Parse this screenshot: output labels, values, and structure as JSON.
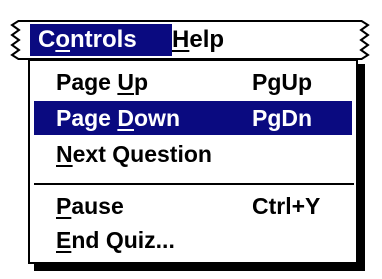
{
  "menubar": {
    "menus": [
      {
        "pre": "C",
        "accel": "o",
        "post": "ntrols",
        "selected": true
      },
      {
        "pre": "",
        "accel": "H",
        "post": "elp",
        "selected": false
      }
    ]
  },
  "dropdown": {
    "items": [
      {
        "pre": "Page ",
        "accel": "U",
        "post": "p",
        "shortcut": "PgUp",
        "selected": false
      },
      {
        "pre": "Page ",
        "accel": "D",
        "post": "own",
        "shortcut": "PgDn",
        "selected": true
      },
      {
        "pre": "",
        "accel": "N",
        "post": "ext Question",
        "shortcut": "",
        "selected": false
      },
      {
        "pre": "",
        "accel": "P",
        "post": "ause",
        "shortcut": "Ctrl+Y",
        "selected": false
      },
      {
        "pre": "",
        "accel": "E",
        "post": "nd Quiz...",
        "shortcut": "",
        "selected": false
      }
    ]
  },
  "colors": {
    "highlight": "#0a0a80",
    "highlight_text": "#ffffff",
    "text": "#000000",
    "background": "#ffffff"
  }
}
